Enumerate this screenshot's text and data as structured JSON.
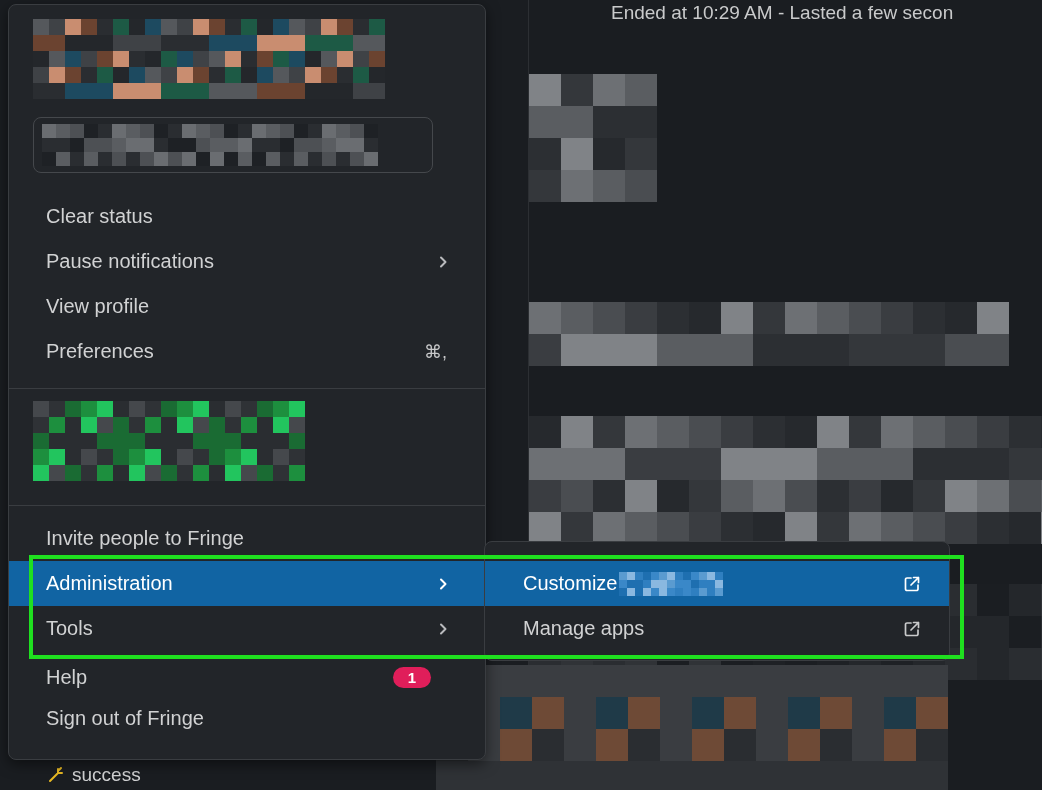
{
  "background": {
    "call_status": "Ended at 10:29 AM - Lasted a few secon",
    "status_text": "success"
  },
  "menu": {
    "sections": [
      {
        "kind": "profile"
      },
      {
        "kind": "items",
        "items": [
          {
            "label": "Clear status",
            "selected": false,
            "submenu": false
          },
          {
            "label": "Pause notifications",
            "selected": false,
            "submenu": true
          },
          {
            "label": "View profile",
            "selected": false,
            "submenu": false
          },
          {
            "label": "Preferences",
            "selected": false,
            "submenu": false,
            "shortcut": "⌘,"
          }
        ]
      },
      {
        "kind": "workspace"
      },
      {
        "kind": "items",
        "items": [
          {
            "label": "Invite people to Fringe",
            "selected": false,
            "submenu": false
          },
          {
            "label": "Administration",
            "selected": true,
            "submenu": true
          },
          {
            "label": "Tools",
            "selected": false,
            "submenu": true
          },
          {
            "label": "Help",
            "selected": false,
            "submenu": false,
            "badge": "1"
          },
          {
            "label": "Sign out of Fringe",
            "selected": false,
            "submenu": false
          }
        ]
      }
    ]
  },
  "submenu": {
    "items": [
      {
        "label": "Customize",
        "selected": true,
        "external": true,
        "redacted": true
      },
      {
        "label": "Manage apps",
        "selected": false,
        "external": true,
        "redacted": false
      }
    ]
  },
  "annotation": {
    "kind": "highlight"
  }
}
